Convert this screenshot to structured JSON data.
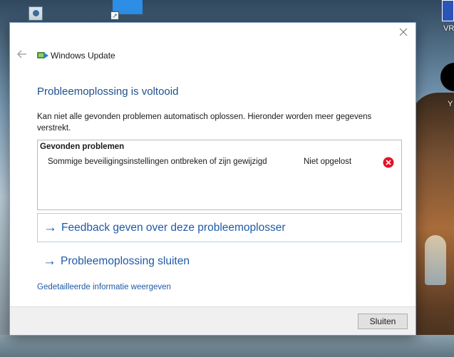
{
  "desktop": {
    "icons": [
      {
        "name": "desktop-shortcut-1"
      },
      {
        "name": "desktop-shortcut-2"
      },
      {
        "name": "desktop-shortcut-3",
        "label": "VR"
      },
      {
        "name": "desktop-shortcut-4",
        "label": "Y"
      }
    ]
  },
  "dialog": {
    "app_title": "Windows Update",
    "app_icon": "windows-update-icon",
    "close_icon": "close-icon",
    "back_icon": "back-arrow-icon",
    "heading": "Probleemoplossing is voltooid",
    "description": "Kan niet alle gevonden problemen automatisch oplossen. Hieronder worden meer gegevens verstrekt.",
    "problems": {
      "header": "Gevonden problemen",
      "items": [
        {
          "name": "Sommige beveiligingsinstellingen ontbreken of zijn gewijzigd",
          "status": "Niet opgelost",
          "status_icon": "error-icon",
          "status_color": "#e81123"
        }
      ]
    },
    "links": {
      "feedback": "Feedback geven over deze probleemoplosser",
      "close_troubleshooter": "Probleemoplossing sluiten",
      "detailed_info": "Gedetailleerde informatie weergeven"
    },
    "footer": {
      "close_button": "Sluiten"
    }
  },
  "colors": {
    "accent": "#1e5aa8",
    "heading": "#1e4f8c",
    "error": "#e81123"
  }
}
